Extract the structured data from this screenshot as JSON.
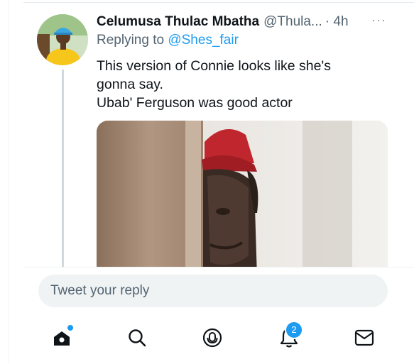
{
  "tweet": {
    "author_name": "Celumusa Thulac Mbatha",
    "author_handle": "@Thula...",
    "time": "· 4h",
    "more_label": "···",
    "replying_prefix": "Replying to",
    "replying_to": "@Shes_fair",
    "text_lines": [
      "This version of Connie looks like she's",
      "gonna say.",
      "Ubab' Ferguson was good actor"
    ]
  },
  "reply": {
    "placeholder": "Tweet your reply"
  },
  "tabbar": {
    "items": [
      {
        "name": "home",
        "icon": "home-icon"
      },
      {
        "name": "search",
        "icon": "search-icon"
      },
      {
        "name": "spaces",
        "icon": "spaces-icon"
      },
      {
        "name": "notifications",
        "icon": "bell-icon",
        "badge": "2"
      },
      {
        "name": "messages",
        "icon": "mail-icon"
      }
    ]
  },
  "colors": {
    "accent": "#1d9bf0",
    "text": "#0f1419",
    "secondary": "#536471",
    "input_bg": "#eff3f4"
  }
}
